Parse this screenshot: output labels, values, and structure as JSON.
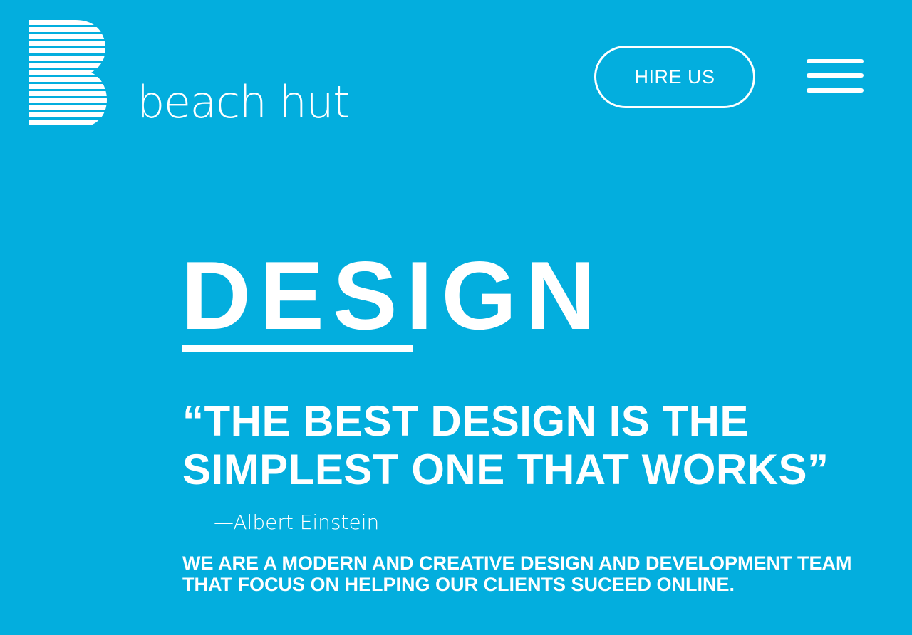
{
  "colors": {
    "background": "#03aede",
    "foreground": "#ffffff"
  },
  "header": {
    "logo": {
      "text": "beach hut",
      "icon": "striped-b-logo-icon"
    },
    "hire_button_label": "HIRE US",
    "menu_icon": "hamburger-menu-icon"
  },
  "hero": {
    "heading": "DESIGN",
    "quote_lines": [
      "“THE BEST DESIGN IS THE",
      "SIMPLEST ONE THAT WORKS”"
    ],
    "attribution": "—Albert Einstein",
    "intro_lines": [
      "WE ARE A MODERN AND CREATIVE DESIGN AND DEVELOPMENT TEAM",
      "THAT FOCUS ON HELPING OUR CLIENTS SUCEED ONLINE."
    ]
  }
}
